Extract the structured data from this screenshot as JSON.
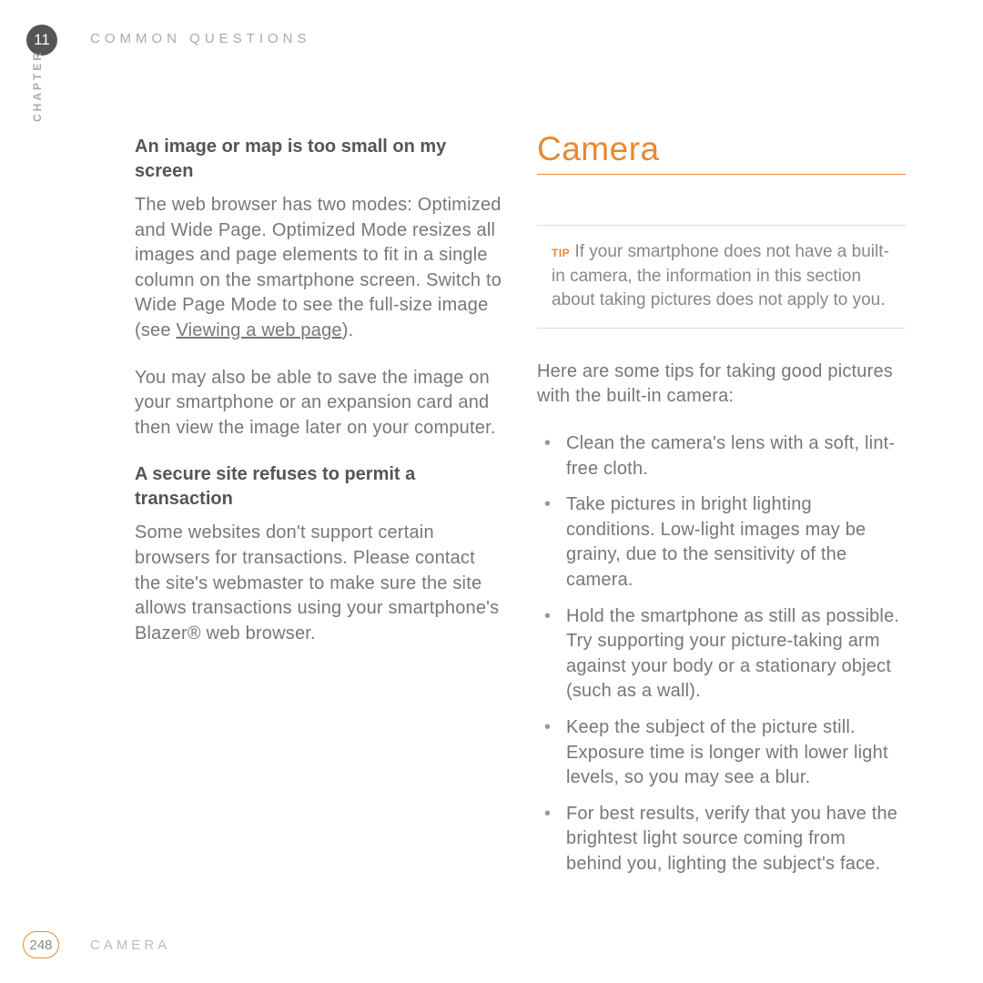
{
  "header": {
    "chapter_number": "11",
    "header_title": "COMMON QUESTIONS",
    "chapter_side_label": "CHAPTER"
  },
  "left_column": {
    "heading1": "An image or map is too small on my screen",
    "para1a": "The web browser has two modes: Optimized and Wide Page. Optimized Mode resizes all images and page elements to fit in a single column on the smartphone screen. Switch to Wide Page Mode to see the full-size image (see ",
    "para1_link": "Viewing a web page",
    "para1b": ").",
    "para2": "You may also be able to save the image on your smartphone or an expansion card and then view the image later on your computer.",
    "heading2": "A secure site refuses to permit a transaction",
    "para3": "Some websites don't support certain browsers for transactions. Please contact the site's webmaster to make sure the site allows transactions using your smartphone's Blazer® web browser."
  },
  "right_column": {
    "section_title": "Camera",
    "tip_label": "TIP",
    "tip_text": "If your smartphone does not have a built-in camera, the information in this section about taking pictures does not apply to you.",
    "intro": "Here are some tips for taking good pictures with the built-in camera:",
    "bullets": [
      "Clean the camera's lens with a soft, lint-free cloth.",
      "Take pictures in bright lighting conditions. Low-light images may be grainy, due to the sensitivity of the camera.",
      "Hold the smartphone as still as possible. Try supporting your picture-taking arm against your body or a stationary object (such as a wall).",
      "Keep the subject of the picture still. Exposure time is longer with lower light levels, so you may see a blur.",
      "For best results, verify that you have the brightest light source coming from behind you, lighting the subject's face."
    ]
  },
  "footer": {
    "page_number": "248",
    "footer_title": "CAMERA"
  }
}
